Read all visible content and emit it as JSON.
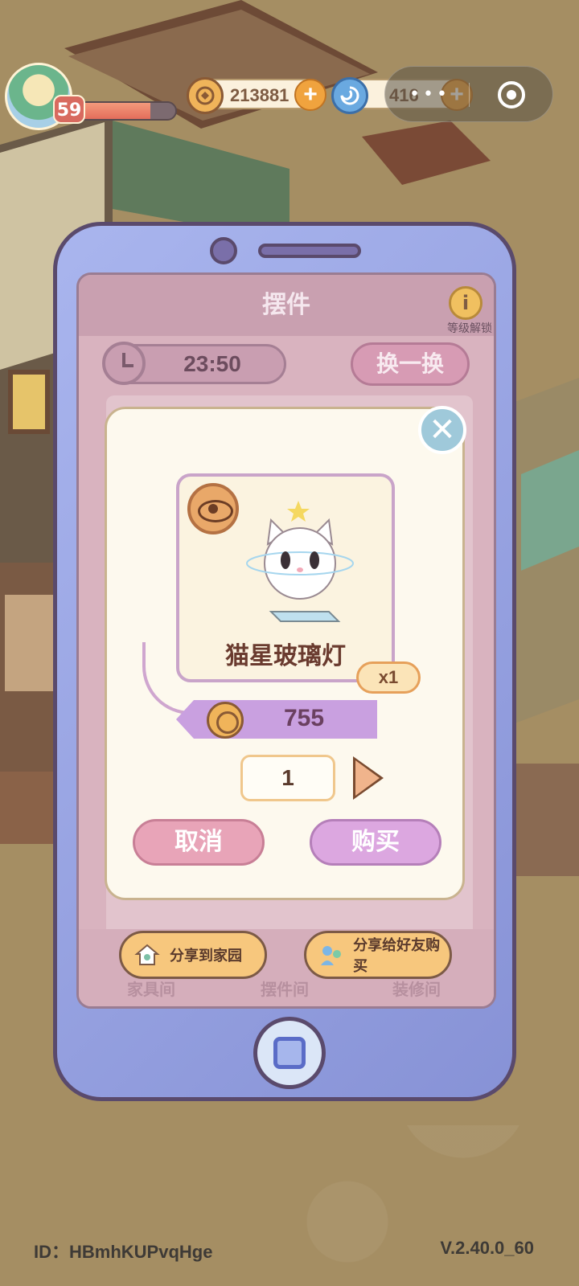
{
  "hud": {
    "level": "59",
    "level_progress": 0.78,
    "coins": "213881",
    "gems": "416",
    "coin_icon": "coin-icon",
    "gem_icon": "swirl-gem-icon"
  },
  "phone_screen": {
    "title": "摆件",
    "info_label": "等级解锁",
    "timer": "23:50",
    "refresh_label": "换一换",
    "tabs": [
      "家具间",
      "摆件间",
      "装修间"
    ]
  },
  "share": {
    "home_label": "分享到家园",
    "friend_label": "分享给好友购买"
  },
  "dialog": {
    "item_name": "猫星玻璃灯",
    "quantity_tag": "x1",
    "price": "755",
    "count": "1",
    "cancel_label": "取消",
    "buy_label": "购买"
  },
  "footer": {
    "id": "ID：HBmhKUPvqHge",
    "version": "V.2.40.0_60"
  },
  "colors": {
    "phone_body": "#8792d6",
    "dialog_bg": "#fdf9ee",
    "buy_button": "#dca7e0",
    "cancel_button": "#e8a4b8",
    "price_tag": "#c9a0e0"
  }
}
